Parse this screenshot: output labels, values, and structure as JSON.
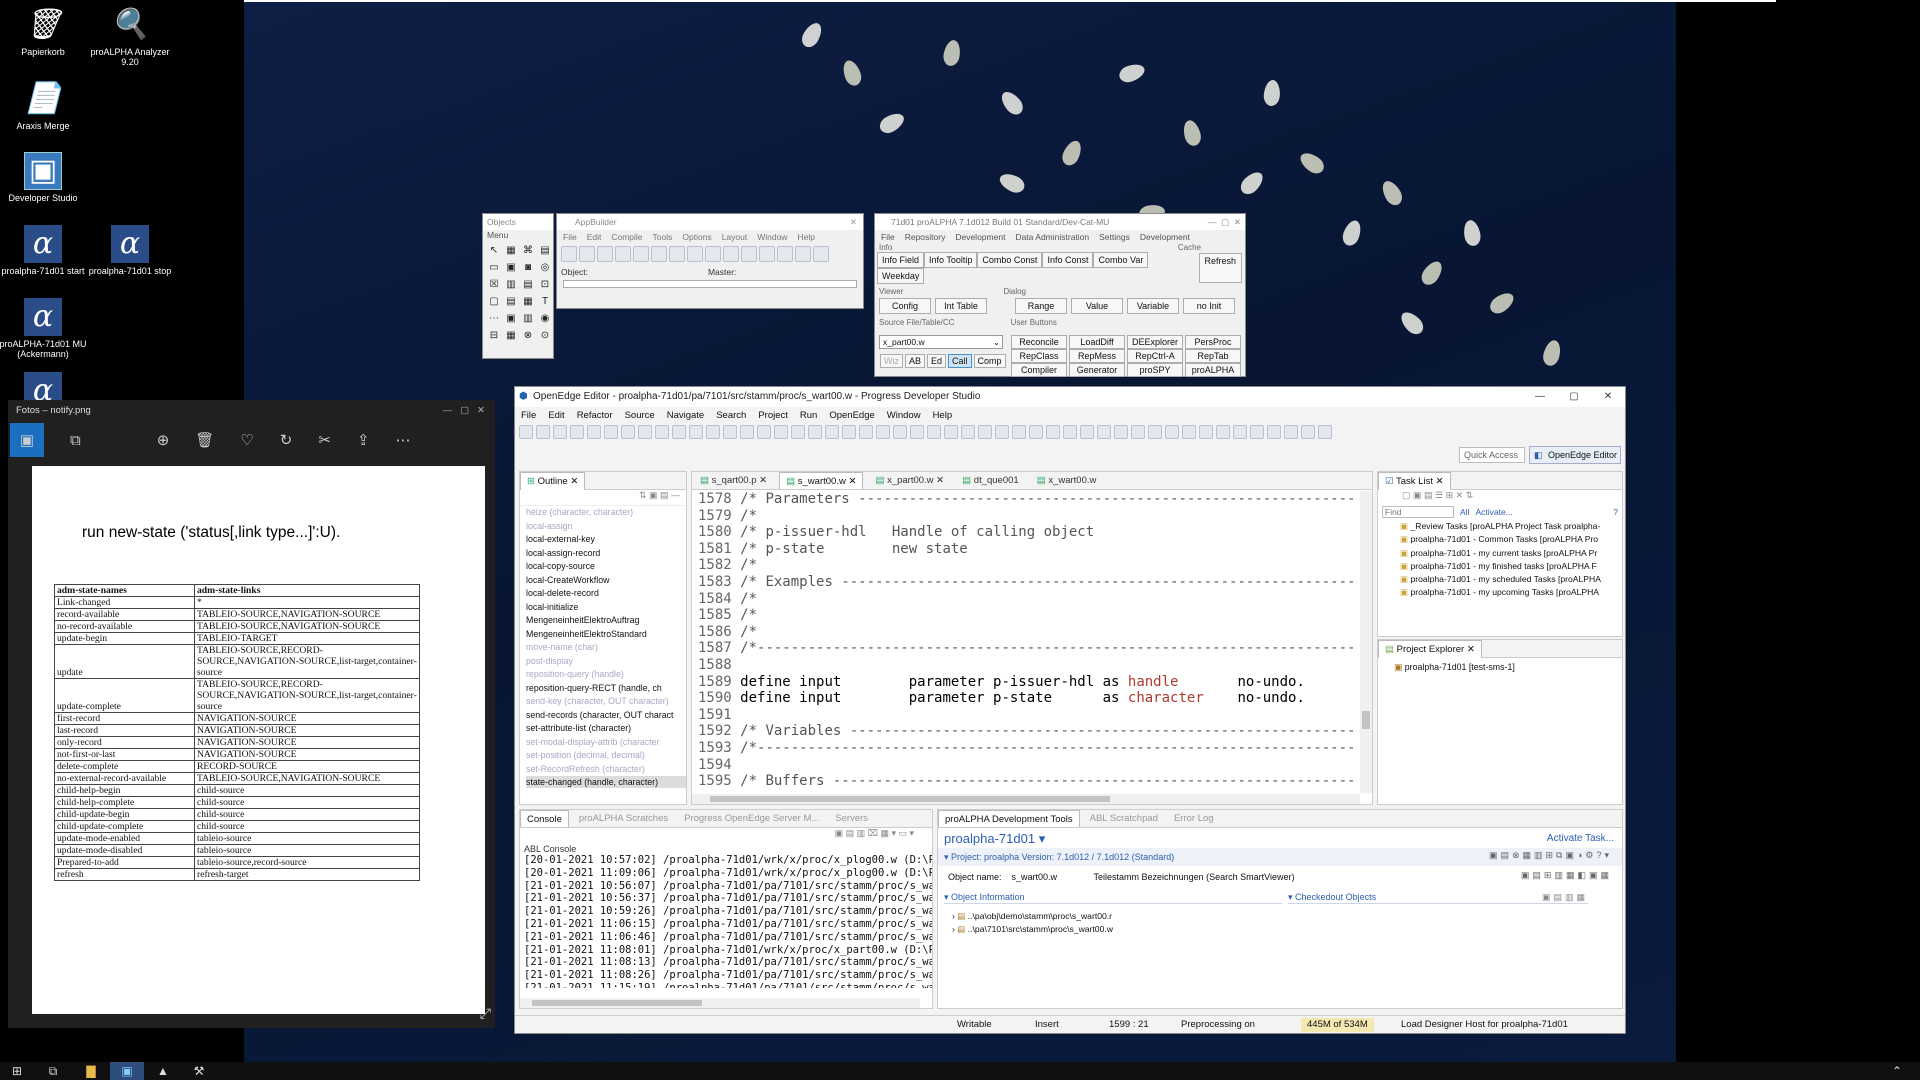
{
  "desktop": {
    "icons": [
      {
        "label": "Papierkorb",
        "glyph": "🗑"
      },
      {
        "label": "proALPHA Analyzer 9.20",
        "glyph": "🔍"
      },
      {
        "label": "Araxis Merge",
        "glyph": "📄"
      },
      {
        "label": "Developer Studio",
        "glyph": "▣"
      },
      {
        "label": "proalpha-71d01 start",
        "glyph": "α"
      },
      {
        "label": "proalpha-71d01 stop",
        "glyph": "α"
      },
      {
        "label": "proALPHA-71d01 MU (Ackermann)",
        "glyph": "α"
      },
      {
        "label": "",
        "glyph": "α"
      }
    ]
  },
  "photos": {
    "title": "Fotos – notify.png",
    "headline": "run new-state ('status[,link type...]':U).",
    "table_headers": [
      "adm-state-names",
      "adm-state-links"
    ],
    "rows": [
      [
        "Link-changed",
        "*"
      ],
      [
        "record-available",
        "TABLEIO-SOURCE,NAVIGATION-SOURCE"
      ],
      [
        "no-record-available",
        "TABLEIO-SOURCE,NAVIGATION-SOURCE"
      ],
      [
        "update-begin",
        "TABLEIO-TARGET"
      ],
      [
        "update",
        "TABLEIO-SOURCE,RECORD-SOURCE,NAVIGATION-SOURCE,list-target,container-source"
      ],
      [
        "update-complete",
        "TABLEIO-SOURCE,RECORD-SOURCE,NAVIGATION-SOURCE,list-target,container-source"
      ],
      [
        "first-record",
        "NAVIGATION-SOURCE"
      ],
      [
        "last-record",
        "NAVIGATION-SOURCE"
      ],
      [
        "only-record",
        "NAVIGATION-SOURCE"
      ],
      [
        "not-first-or-last",
        "NAVIGATION-SOURCE"
      ],
      [
        "delete-complete",
        "RECORD-SOURCE"
      ],
      [
        "no-external-record-available",
        "TABLEIO-SOURCE,NAVIGATION-SOURCE"
      ],
      [
        "child-help-begin",
        "child-source"
      ],
      [
        "child-help-complete",
        "child-source"
      ],
      [
        "child-update-begin",
        "child-source"
      ],
      [
        "child-update-complete",
        "child-source"
      ],
      [
        "update-mode-enabled",
        "tableio-source"
      ],
      [
        "update-mode-disabled",
        "tableio-source"
      ],
      [
        "Prepared-to-add",
        "tableio-source,record-source"
      ],
      [
        "refresh",
        "refresh-target"
      ]
    ]
  },
  "palette": {
    "title": "Objects",
    "menu": "Menu"
  },
  "appbuilder": {
    "title": "AppBuilder",
    "menus": [
      "File",
      "Edit",
      "Compile",
      "Tools",
      "Options",
      "Layout",
      "Window",
      "Help"
    ],
    "object_label": "Object:",
    "master_label": "Master:"
  },
  "devtool": {
    "title": "71d01 proALPHA 7.1d012 Build 01 Standard/Dev-Cat-MU",
    "menus": [
      "File",
      "Repository",
      "Development",
      "Data Administration",
      "Settings",
      "Development"
    ],
    "info_label": "Info",
    "cache_label": "Cache",
    "info_buttons": [
      "Info Field",
      "Info Tooltip",
      "Combo Const",
      "Info Const",
      "Combo Var",
      "Weekday"
    ],
    "refresh": "Refresh",
    "viewer_label": "Viewer",
    "dialog_label": "Dialog",
    "viewer_buttons": [
      "Config",
      "Int Table"
    ],
    "dialog_buttons": [
      "Range",
      "Value",
      "Variable",
      "no Init"
    ],
    "source_label": "Source File/Table/CC",
    "source_value": "x_part00.w",
    "mode_buttons": [
      "Wiz",
      "AB",
      "Ed",
      "Call",
      "Comp"
    ],
    "user_buttons_label": "User Buttons",
    "user_buttons": [
      "Reconcile",
      "LoadDiff",
      "DEExplorer",
      "PersProc",
      "RepClass",
      "RepMess",
      "RepCtrl-A",
      "RepTab",
      "Compiler",
      "Generator",
      "proSPY",
      "proALPHA"
    ]
  },
  "editor": {
    "title": "OpenEdge Editor - proalpha-71d01/pa/7101/src/stamm/proc/s_wart00.w - Progress Developer Studio",
    "menus": [
      "File",
      "Edit",
      "Refactor",
      "Source",
      "Navigate",
      "Search",
      "Project",
      "Run",
      "OpenEdge",
      "Window",
      "Help"
    ],
    "quick_access": "Quick Access",
    "perspective": "OpenEdge Editor",
    "outline_title": "Outline",
    "outline_items": [
      "heize (character, character)",
      "local-assign",
      "local-external-key",
      "local-assign-record",
      "local-copy-source",
      "local-CreateWorkflow",
      "local-delete-record",
      "local-initialize",
      "MengeneinheitElektroAuftrag",
      "MengeneinheitElektroStandard",
      "move-name (char)",
      "post-display",
      "reposition-query (handle)",
      "reposition-query-RECT (handle, ch",
      "send-key (character, OUT character)",
      "send-records (character, OUT charact",
      "set-attribute-list (character)",
      "set-modal-display-attrib (character",
      "set-position (decimal, decimal)",
      "set-RecordRefresh (character)",
      "state-changed (handle, character)"
    ],
    "editor_tabs": [
      "s_qart00.p",
      "s_wart00.w",
      "x_part00.w",
      "dt_que001",
      "x_wart00.w"
    ],
    "code_lines": [
      {
        "n": "1578",
        "parts": [
          [
            "cm",
            "/* Parameters --------------------------------------------------------------"
          ]
        ]
      },
      {
        "n": "1579",
        "parts": [
          [
            "cm",
            "/*"
          ]
        ]
      },
      {
        "n": "1580",
        "parts": [
          [
            "cm",
            "/* p-issuer-hdl   Handle of calling object"
          ]
        ]
      },
      {
        "n": "1581",
        "parts": [
          [
            "cm",
            "/* p-state        new state"
          ]
        ]
      },
      {
        "n": "1582",
        "parts": [
          [
            "cm",
            "/*"
          ]
        ]
      },
      {
        "n": "1583",
        "parts": [
          [
            "cm",
            "/* Examples ----------------------------------------------------------------"
          ]
        ]
      },
      {
        "n": "1584",
        "parts": [
          [
            "cm",
            "/*"
          ]
        ]
      },
      {
        "n": "1585",
        "parts": [
          [
            "cm",
            "/*"
          ]
        ]
      },
      {
        "n": "1586",
        "parts": [
          [
            "cm",
            "/*"
          ]
        ]
      },
      {
        "n": "1587",
        "parts": [
          [
            "cm",
            "/*---------------------------------------------------------------------------"
          ]
        ]
      },
      {
        "n": "1588",
        "parts": [
          [
            "kw",
            ""
          ]
        ]
      },
      {
        "n": "1589",
        "parts": [
          [
            "kw",
            "define input        parameter p-issuer-hdl "
          ],
          [
            "kw",
            "as "
          ],
          [
            "ty",
            "handle       "
          ],
          [
            "kw",
            "no-undo."
          ]
        ]
      },
      {
        "n": "1590",
        "parts": [
          [
            "kw",
            "define input        parameter p-state      "
          ],
          [
            "kw",
            "as "
          ],
          [
            "ty",
            "character    "
          ],
          [
            "kw",
            "no-undo."
          ]
        ]
      },
      {
        "n": "1591",
        "parts": [
          [
            "kw",
            ""
          ]
        ]
      },
      {
        "n": "1592",
        "parts": [
          [
            "cm",
            "/* Variables ---------------------------------------------------------------"
          ]
        ]
      },
      {
        "n": "1593",
        "parts": [
          [
            "cm",
            "/*---------------------------------------------------------------------------"
          ]
        ]
      },
      {
        "n": "1594",
        "parts": [
          [
            "kw",
            ""
          ]
        ]
      },
      {
        "n": "1595",
        "parts": [
          [
            "cm",
            "/* Buffers -----------------------------------------------------------------"
          ]
        ]
      }
    ],
    "tasklist_title": "Task List",
    "find_placeholder": "Find",
    "all_label": "All",
    "activate_label": "Activate...",
    "tasks": [
      "_Review Tasks  [proALPHA Project Task proalpha-",
      "proalpha-71d01 - Common Tasks  [proALPHA Pro",
      "proalpha-71d01 - my current tasks  [proALPHA Pr",
      "proalpha-71d01 - my finished tasks  [proALPHA F",
      "proalpha-71d01 - my scheduled Tasks  [proALPHA",
      "proalpha-71d01 - my upcoming Tasks  [proALPHA"
    ],
    "project_explorer_title": "Project Explorer",
    "project_item": "proalpha-71d01 [test-sms-1]",
    "console_tabs": [
      "Console",
      "proALPHA Scratches",
      "Progress OpenEdge Server M...",
      "Servers"
    ],
    "console_title": "ABL Console",
    "console_lines": [
      "[20-01-2021 10:57:02] /proalpha-71d01/wrk/x/proc/x_plog00.w (D:\\Pr",
      "[20-01-2021 11:09:06] /proalpha-71d01/wrk/x/proc/x_plog00.w (D:\\Pr",
      "[21-01-2021 10:56:07] /proalpha-71d01/pa/7101/src/stamm/proc/s_war",
      "[21-01-2021 10:56:37] /proalpha-71d01/pa/7101/src/stamm/proc/s_war",
      "[21-01-2021 10:59:26] /proalpha-71d01/pa/7101/src/stamm/proc/s_war",
      "[21-01-2021 11:06:15] /proalpha-71d01/pa/7101/src/stamm/proc/s_war",
      "[21-01-2021 11:06:46] /proalpha-71d01/pa/7101/src/stamm/proc/s_war",
      "[21-01-2021 11:08:01] /proalpha-71d01/wrk/x/proc/x_part00.w (D:\\Pr",
      "[21-01-2021 11:08:13] /proalpha-71d01/pa/7101/src/stamm/proc/s_war",
      "[21-01-2021 11:08:26] /proalpha-71d01/pa/7101/src/stamm/proc/s_war",
      "[21-01-2021 11:15:19] /proalpha-71d01/pa/7101/src/stamm/proc/s_war"
    ],
    "pa_tabs": [
      "proALPHA Development Tools",
      "ABL Scratchpad",
      "Error Log"
    ],
    "pa_project": "proalpha-71d01 ▾",
    "activate_task": "Activate Task...",
    "project_version": "Project: proalpha Version: 7.1d012 / 7.1d012 (Standard)",
    "object_name_label": "Object name:",
    "object_name_value": "s_wart00.w",
    "object_desc": "Teilestamm Bezeichnungen (Search SmartViewer)",
    "object_info": "Object Information",
    "checkedout": "Checkedout Objects",
    "object_paths": [
      "..\\pa\\obj\\demo\\stamm\\proc\\s_wart00.r",
      "..\\pa\\7101\\src\\stamm\\proc\\s_wart00.w"
    ],
    "status": {
      "writable": "Writable",
      "insert": "Insert",
      "pos": "1599 : 21",
      "preprocessing": "Preprocessing on",
      "memory": "445M of 534M",
      "message": "Load Designer Host for proalpha-71d01"
    }
  },
  "taskbar": {
    "items": [
      "start",
      "task-view",
      "explorer",
      "dev-studio",
      "photos",
      "tools"
    ]
  }
}
